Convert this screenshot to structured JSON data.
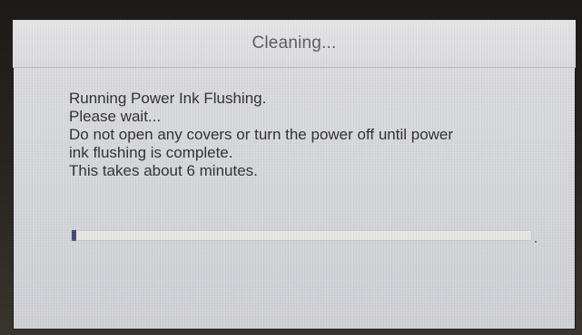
{
  "dialog": {
    "title": "Cleaning...",
    "lines": [
      "Running Power Ink Flushing.",
      "Please wait...",
      "Do not open any covers or turn the power off until power",
      "ink flushing is complete.",
      "This takes about 6 minutes."
    ]
  },
  "progress": {
    "value_percent": 1
  },
  "colors": {
    "screen_background": "#d6d7db",
    "title_text": "#5a5a5e",
    "body_text": "#2e2e33",
    "progress_track": "#e6e6e2",
    "progress_fill": "#3c4a78"
  }
}
